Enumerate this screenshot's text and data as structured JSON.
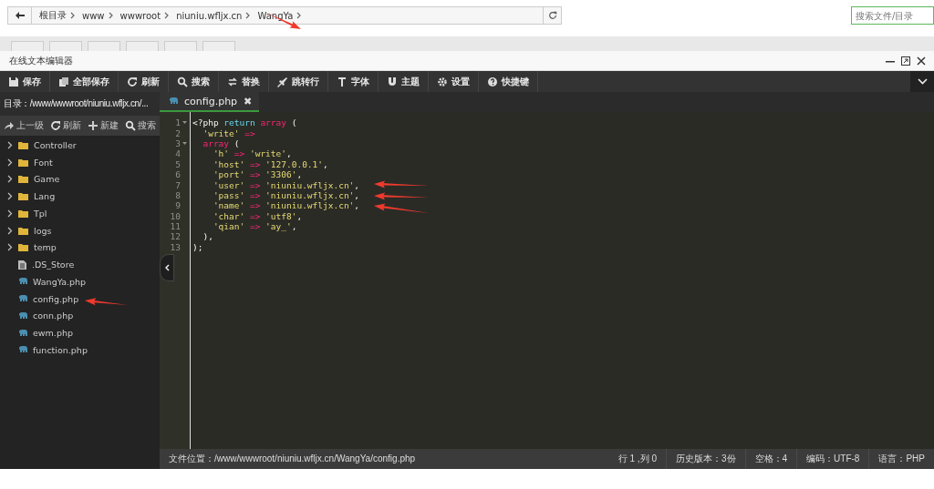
{
  "breadcrumb": {
    "items": [
      "根目录",
      "www",
      "wwwroot",
      "niuniu.wfljx.cn",
      "WangYa"
    ]
  },
  "file_search": {
    "placeholder": "搜索文件/目录"
  },
  "editor_window": {
    "title": "在线文本编辑器"
  },
  "toolbar": [
    {
      "kind": "save",
      "label": "保存"
    },
    {
      "kind": "save-all",
      "label": "全部保存"
    },
    {
      "kind": "refresh",
      "label": "刷新"
    },
    {
      "kind": "search",
      "label": "搜索"
    },
    {
      "kind": "replace",
      "label": "替换"
    },
    {
      "kind": "jump",
      "label": "跳转行"
    },
    {
      "kind": "font",
      "label": "字体"
    },
    {
      "kind": "theme",
      "label": "主题"
    },
    {
      "kind": "settings",
      "label": "设置"
    },
    {
      "kind": "help",
      "label": "快捷键"
    }
  ],
  "sidebar": {
    "path": "目录：/www/wwwroot/niuniu.wfljx.cn/...",
    "actions": [
      {
        "kind": "up",
        "label": "上一级"
      },
      {
        "kind": "refresh",
        "label": "刷新"
      },
      {
        "kind": "new",
        "label": "新建"
      },
      {
        "kind": "search",
        "label": "搜索"
      }
    ],
    "items": [
      {
        "kind": "folder",
        "name": "Controller",
        "expanded": false
      },
      {
        "kind": "folder",
        "name": "Font",
        "expanded": false
      },
      {
        "kind": "folder",
        "name": "Game",
        "expanded": false
      },
      {
        "kind": "folder",
        "name": "Lang",
        "expanded": false
      },
      {
        "kind": "folder",
        "name": "Tpl",
        "expanded": false
      },
      {
        "kind": "folder",
        "name": "logs",
        "expanded": false
      },
      {
        "kind": "folder",
        "name": "temp",
        "expanded": false
      },
      {
        "kind": "file",
        "name": ".DS_Store"
      },
      {
        "kind": "php",
        "name": "WangYa.php"
      },
      {
        "kind": "php",
        "name": "config.php"
      },
      {
        "kind": "php",
        "name": "conn.php"
      },
      {
        "kind": "php",
        "name": "ewm.php"
      },
      {
        "kind": "php",
        "name": "function.php"
      }
    ]
  },
  "tabs": [
    {
      "label": "config.php",
      "selected": true,
      "close": "✖"
    }
  ],
  "code_lines": [
    {
      "number": "1",
      "fold": true,
      "tokens": [
        {
          "kind": "tag",
          "text": "<?php"
        },
        {
          "kind": "keyword",
          "text": " return"
        },
        {
          "kind": "builtin",
          "text": " array"
        },
        {
          "kind": "plain",
          "text": " ("
        }
      ]
    },
    {
      "number": "2",
      "fold": false,
      "tokens": [
        {
          "kind": "string",
          "text": "  'write'"
        },
        {
          "kind": "operator",
          "text": " =>"
        }
      ]
    },
    {
      "number": "3",
      "fold": true,
      "tokens": [
        {
          "kind": "builtin",
          "text": "  array"
        },
        {
          "kind": "plain",
          "text": " ("
        }
      ]
    },
    {
      "number": "4",
      "fold": false,
      "tokens": [
        {
          "kind": "string",
          "text": "    'h'"
        },
        {
          "kind": "operator",
          "text": " =>"
        },
        {
          "kind": "string",
          "text": " 'write'"
        },
        {
          "kind": "plain",
          "text": ","
        }
      ]
    },
    {
      "number": "5",
      "fold": false,
      "tokens": [
        {
          "kind": "string",
          "text": "    'host'"
        },
        {
          "kind": "operator",
          "text": " =>"
        },
        {
          "kind": "string",
          "text": " '127.0.0.1'"
        },
        {
          "kind": "plain",
          "text": ","
        }
      ]
    },
    {
      "number": "6",
      "fold": false,
      "tokens": [
        {
          "kind": "string",
          "text": "    'port'"
        },
        {
          "kind": "operator",
          "text": " =>"
        },
        {
          "kind": "string",
          "text": " '3306'"
        },
        {
          "kind": "plain",
          "text": ","
        }
      ]
    },
    {
      "number": "7",
      "fold": false,
      "tokens": [
        {
          "kind": "string",
          "text": "    'user'"
        },
        {
          "kind": "operator",
          "text": " =>"
        },
        {
          "kind": "string",
          "text": " 'niuniu.wfljx.cn'"
        },
        {
          "kind": "plain",
          "text": ","
        }
      ]
    },
    {
      "number": "8",
      "fold": false,
      "tokens": [
        {
          "kind": "string",
          "text": "    'pass'"
        },
        {
          "kind": "operator",
          "text": " =>"
        },
        {
          "kind": "string",
          "text": " 'niuniu.wfljx.cn'"
        },
        {
          "kind": "plain",
          "text": ","
        }
      ]
    },
    {
      "number": "9",
      "fold": false,
      "tokens": [
        {
          "kind": "string",
          "text": "    'name'"
        },
        {
          "kind": "operator",
          "text": " =>"
        },
        {
          "kind": "string",
          "text": " 'niuniu.wfljx.cn'"
        },
        {
          "kind": "plain",
          "text": ","
        }
      ]
    },
    {
      "number": "10",
      "fold": false,
      "tokens": [
        {
          "kind": "string",
          "text": "    'char'"
        },
        {
          "kind": "operator",
          "text": " =>"
        },
        {
          "kind": "string",
          "text": " 'utf8'"
        },
        {
          "kind": "plain",
          "text": ","
        }
      ]
    },
    {
      "number": "11",
      "fold": false,
      "tokens": [
        {
          "kind": "string",
          "text": "    'qian'"
        },
        {
          "kind": "operator",
          "text": " =>"
        },
        {
          "kind": "string",
          "text": " 'ay_'"
        },
        {
          "kind": "plain",
          "text": ","
        }
      ]
    },
    {
      "number": "12",
      "fold": false,
      "tokens": [
        {
          "kind": "plain",
          "text": "  ),"
        }
      ]
    },
    {
      "number": "13",
      "fold": false,
      "tokens": [
        {
          "kind": "plain",
          "text": ");"
        }
      ]
    }
  ],
  "status_bar": {
    "file_path": "文件位置：/www/wwwroot/niuniu.wfljx.cn/WangYa/config.php",
    "items": [
      "行 1 ,列 0",
      "历史版本：3份",
      "空格：4",
      "编码：UTF-8",
      "语言：PHP"
    ]
  }
}
